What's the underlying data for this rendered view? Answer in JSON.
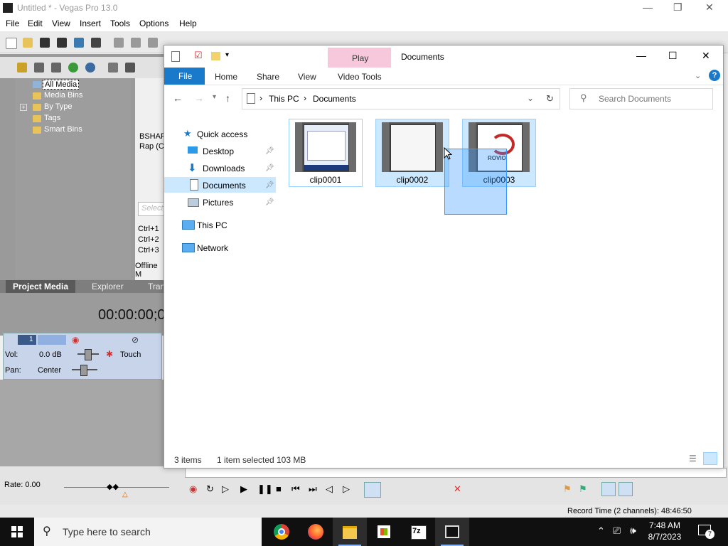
{
  "vegas": {
    "title": "Untitled * - Vegas Pro 13.0",
    "menu": [
      "File",
      "Edit",
      "View",
      "Insert",
      "Tools",
      "Options",
      "Help"
    ],
    "tree": [
      "All Media",
      "Media Bins",
      "By Type",
      "Tags",
      "Smart Bins"
    ],
    "right_text_1": "BSHAP",
    "right_text_2": "Rap (C",
    "right_search": "Select",
    "shortcuts": [
      "Ctrl+1",
      "Ctrl+2",
      "Ctrl+3"
    ],
    "offline_label": "Offline M",
    "tabs": [
      "Project Media",
      "Explorer",
      "Tran"
    ],
    "timecode": "00:00:00;0",
    "track_number": "1",
    "vol_label": "Vol:",
    "vol_value": "0.0 dB",
    "pan_label": "Pan:",
    "pan_value": "Center",
    "touch_label": "Touch",
    "rate": "Rate: 0.00",
    "record_time": "Record Time (2 channels): 48:46:50"
  },
  "explorer": {
    "title": "Documents",
    "context_tab": "Play",
    "ribbon_tabs": {
      "file": "File",
      "home": "Home",
      "share": "Share",
      "view": "View",
      "video_tools": "Video Tools"
    },
    "breadcrumb": [
      "This PC",
      "Documents"
    ],
    "search_placeholder": "Search Documents",
    "nav": {
      "quick_access": "Quick access",
      "desktop": "Desktop",
      "downloads": "Downloads",
      "documents": "Documents",
      "pictures": "Pictures",
      "this_pc": "This PC",
      "network": "Network"
    },
    "files": [
      {
        "name": "clip0001",
        "state": "outlined"
      },
      {
        "name": "clip0002",
        "state": "selected"
      },
      {
        "name": "clip0003",
        "state": "selected",
        "thumb_text": "ROVIO"
      }
    ],
    "status": {
      "count": "3 items",
      "selection": "1 item selected",
      "size": "103 MB"
    }
  },
  "taskbar": {
    "search_placeholder": "Type here to search",
    "apps": [
      "chrome-icon",
      "firefox-icon",
      "file-explorer-icon",
      "store-icon",
      "7zip-icon",
      "vegas-icon"
    ],
    "time": "7:48 AM",
    "date": "8/7/2023",
    "notifications": "7",
    "zip_label": "7z"
  },
  "colors": {
    "accent": "#1979ca",
    "selection": "#cce8ff",
    "selection_border": "#99d1ff",
    "play_tab": "#f7c8dc",
    "taskbar": "#101010"
  }
}
